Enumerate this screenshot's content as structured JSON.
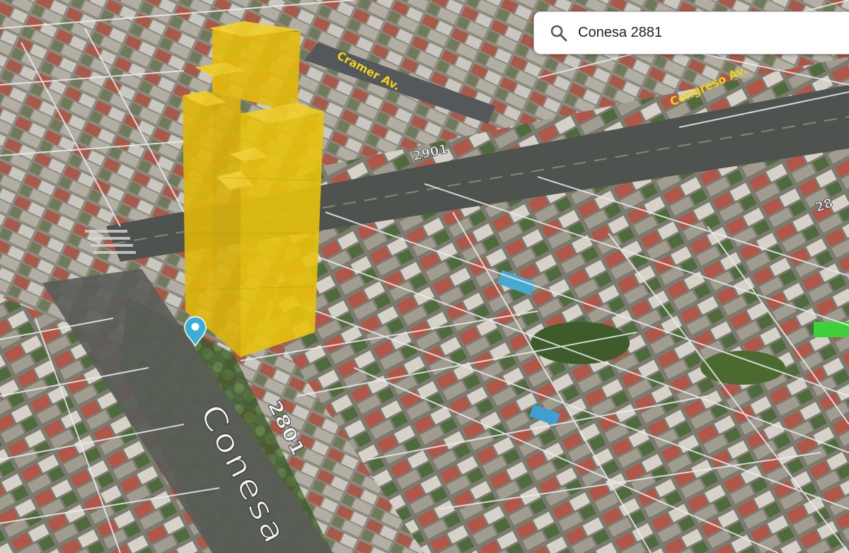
{
  "search": {
    "value": "Conesa 2881",
    "icon": "search-icon"
  },
  "streets": {
    "conesa": "Conesa",
    "conesa_number": "2801",
    "cramer": "Cramer Av.",
    "congreso": "Congreso Av.",
    "congreso_number": "2901",
    "number_right": "28"
  },
  "marker": {
    "icon": "location-pin-icon",
    "color": "#3aaed8"
  },
  "building": {
    "color": "#e8c20c"
  }
}
